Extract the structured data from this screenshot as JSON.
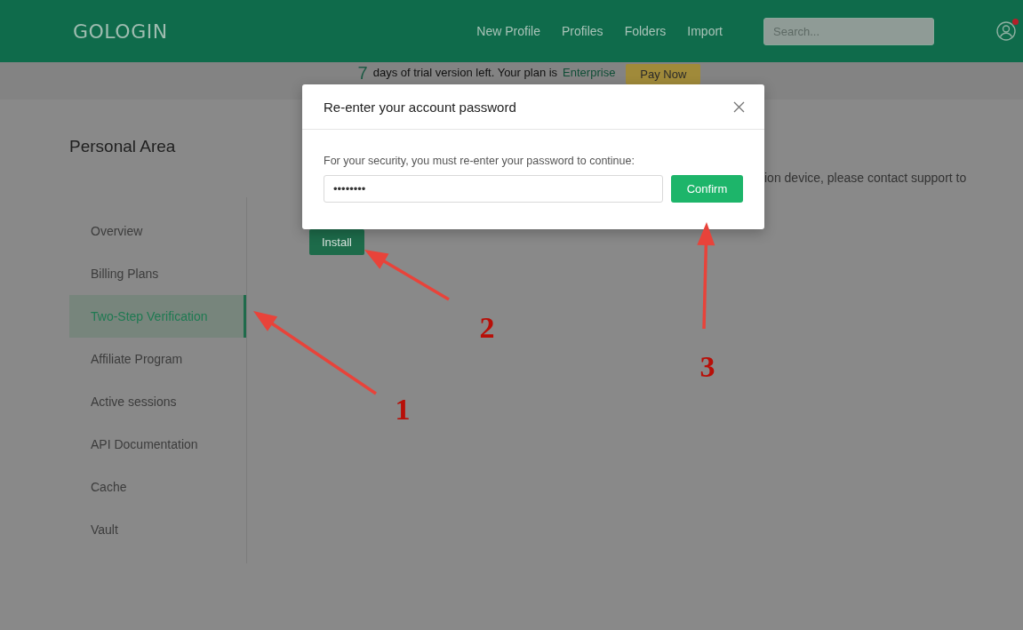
{
  "header": {
    "logo": "GOLOGIN",
    "nav": [
      {
        "label": "New Profile"
      },
      {
        "label": "Profiles"
      },
      {
        "label": "Folders"
      },
      {
        "label": "Import"
      }
    ],
    "search": {
      "placeholder": "Search..."
    },
    "notification": true
  },
  "banner": {
    "days": "7",
    "text": "days of trial version left. Your plan is",
    "plan": "Enterprise",
    "button": "Pay Now"
  },
  "sidebar": {
    "title": "Personal Area",
    "items": [
      {
        "label": "Overview",
        "selected": false
      },
      {
        "label": "Billing Plans",
        "selected": false
      },
      {
        "label": "Two-Step Verification",
        "selected": true
      },
      {
        "label": "Affiliate Program",
        "selected": false
      },
      {
        "label": "Active sessions",
        "selected": false
      },
      {
        "label": "API Documentation",
        "selected": false
      },
      {
        "label": "Cache",
        "selected": false
      },
      {
        "label": "Vault",
        "selected": false
      }
    ]
  },
  "content": {
    "text": "ion device, please contact support to",
    "button": "Install"
  },
  "modal": {
    "title": "Re-enter your account password",
    "message": "For your security, you must re-enter your password to continue:",
    "password": "••••••••",
    "button": "Confirm"
  },
  "annotations": [
    {
      "label": "1"
    },
    {
      "label": "2"
    },
    {
      "label": "3"
    }
  ]
}
